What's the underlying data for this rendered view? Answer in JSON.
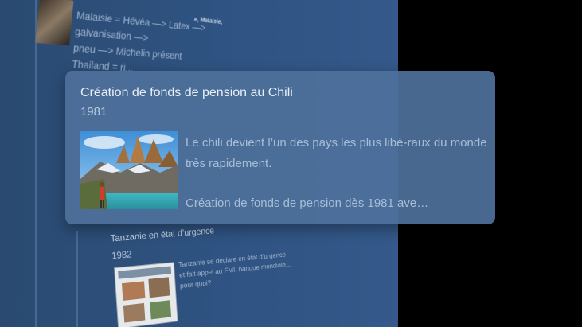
{
  "top_entry": {
    "corner_text": "e, Malaisie,",
    "lines": [
      "Malaisie = Hévéa —> Latex —> galvanisation —>",
      "pneu —> Michelin présent",
      "Thailand = ri..."
    ]
  },
  "card": {
    "title": "Création de fonds de pension au Chili",
    "year": "1981",
    "paragraph1": "Le chili devient l’un des pays les plus libé-raux du monde très rapidement.",
    "paragraph2": "Création de fonds de pension dès 1981 ave…"
  },
  "bottom_entry": {
    "title": "Tanzanie en état d’urgence",
    "year": "1982",
    "text": "Tanzanie se déclare en état d’urgence et fait appel au FMI, banque mondiale... pour quoi?"
  },
  "colors": {
    "panel": "#2f5382",
    "card": "#4e709b",
    "background": "#000000"
  }
}
